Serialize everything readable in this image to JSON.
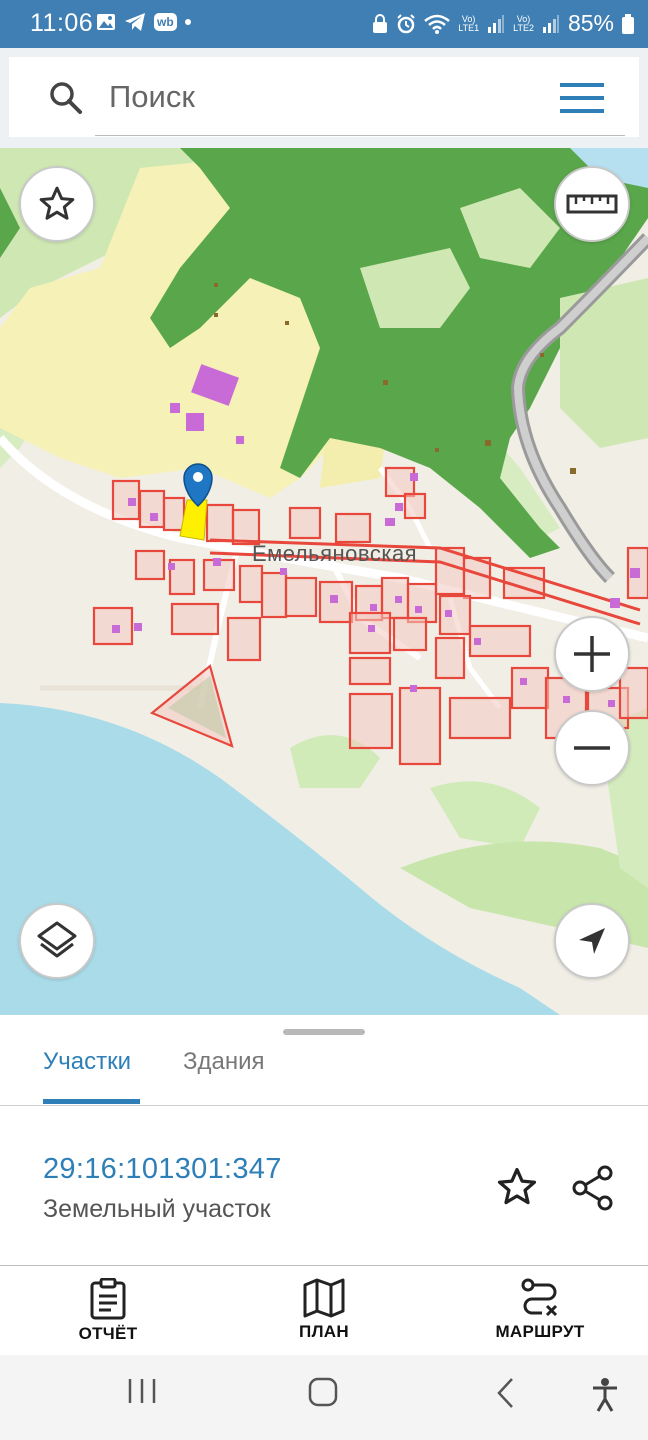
{
  "status_bar": {
    "time": "11:06",
    "wb_badge": "wb",
    "sim1": "Vo)\nLTE1",
    "sim2": "Vo)\nLTE2",
    "battery": "85%"
  },
  "search": {
    "placeholder": "Поиск"
  },
  "map": {
    "street_label": "Емельяновская",
    "colors": {
      "forest": "#5aa64b",
      "meadow": "#bfe39e",
      "field": "#f6f1b6",
      "water": "#aadbe8",
      "parcel_outline": "#e8473c",
      "parcel_fill": "#f3c9bf",
      "buildings": "#c86bd6",
      "selected_parcel": "#ffef00",
      "marker": "#1f76c3",
      "road": "#ffffff"
    }
  },
  "sheet": {
    "tabs": [
      {
        "label": "Участки",
        "active": true
      },
      {
        "label": "Здания",
        "active": false
      }
    ],
    "parcel": {
      "cadastral_number": "29:16:101301:347",
      "type": "Земельный участок"
    }
  },
  "actions": [
    {
      "label": "ОТЧЁТ",
      "icon": "report-icon"
    },
    {
      "label": "ПЛАН",
      "icon": "map-plan-icon"
    },
    {
      "label": "МАРШРУТ",
      "icon": "route-icon"
    }
  ],
  "accent_color": "#2e7fb8"
}
